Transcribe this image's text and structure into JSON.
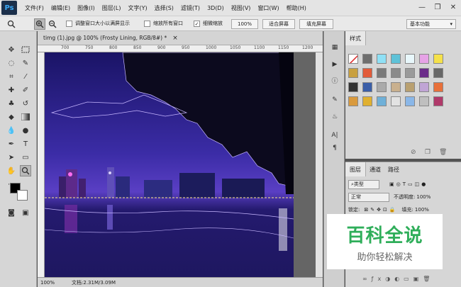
{
  "app": {
    "logo": "Ps"
  },
  "menu": [
    "文件(F)",
    "编辑(E)",
    "图像(I)",
    "图层(L)",
    "文字(Y)",
    "选择(S)",
    "滤镜(T)",
    "3D(D)",
    "视图(V)",
    "窗口(W)",
    "帮助(H)"
  ],
  "window_controls": {
    "minimize": "—",
    "restore": "❐",
    "close": "✕"
  },
  "options": {
    "resize_window": "调整窗口大小以满屏显示",
    "zoom_all": "缩放所有窗口",
    "scrubby_zoom": "细微缩放",
    "zoom_100": "100%",
    "fit_screen": "适合屏幕",
    "fill_screen": "填充屏幕",
    "workspace": "基本功能"
  },
  "document": {
    "tab_title": "timg (1).jpg @ 100% (Frosty Lining, RGB/8#) *",
    "close": "×",
    "zoom": "100%",
    "doc_size": "文档:2.31M/3.09M",
    "ruler_ticks": [
      "700",
      "750",
      "800",
      "850",
      "900",
      "950",
      "1000",
      "1050",
      "1100",
      "1150",
      "1200"
    ]
  },
  "styles_panel": {
    "tab": "样式"
  },
  "layers_panel": {
    "tabs": [
      "图层",
      "通道",
      "路径"
    ],
    "kind": "类型",
    "blend_mode": "正常",
    "opacity_label": "不透明度:",
    "opacity_value": "100%",
    "lock_label": "锁定:",
    "fill_label": "填充:",
    "fill_value": "100%"
  },
  "watermark": {
    "title": "百科全说",
    "subtitle": "助你轻松解决"
  },
  "colors": {
    "accent": "#2fae5a",
    "night_sky": "#3a2a9c",
    "bg_panel": "#d6d6d6"
  },
  "icons": [
    "zoom-tool-icon",
    "move-tool-icon",
    "marquee-tool-icon",
    "lasso-tool-icon",
    "crop-tool-icon",
    "eyedropper-tool-icon",
    "brush-tool-icon",
    "stamp-tool-icon",
    "eraser-tool-icon",
    "gradient-tool-icon",
    "pen-tool-icon",
    "type-tool-icon",
    "hand-tool-icon"
  ]
}
